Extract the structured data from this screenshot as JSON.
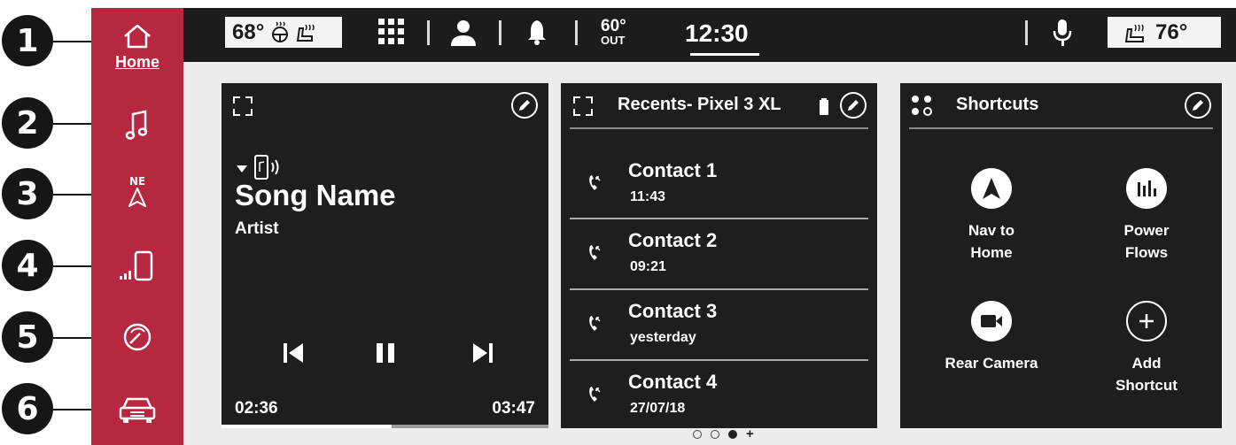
{
  "callouts": [
    "1",
    "2",
    "3",
    "4",
    "5",
    "6"
  ],
  "sidebar": {
    "home_label": "Home",
    "nav_heading": "NE",
    "items": [
      {
        "icon": "home-icon"
      },
      {
        "icon": "music-note-icon"
      },
      {
        "icon": "navigation-arrow-icon"
      },
      {
        "icon": "phone-signal-icon"
      },
      {
        "icon": "gauge-icon"
      },
      {
        "icon": "car-icon"
      }
    ]
  },
  "status_bar": {
    "driver_temp": "68°",
    "outside_temp": "60°",
    "outside_label": "OUT",
    "clock": "12:30",
    "passenger_temp": "76°"
  },
  "media_card": {
    "song": "Song Name",
    "artist": "Artist",
    "elapsed": "02:36",
    "duration": "03:47",
    "progress": 0.52
  },
  "recents_card": {
    "title": "Recents- Pixel 3 XL",
    "contacts": [
      {
        "name": "Contact 1",
        "time": "11:43"
      },
      {
        "name": "Contact 2",
        "time": "09:21"
      },
      {
        "name": "Contact 3",
        "time": "yesterday"
      },
      {
        "name": "Contact 4",
        "time": "27/07/18"
      }
    ]
  },
  "shortcuts_card": {
    "title": "Shortcuts",
    "items": [
      {
        "label": "Nav to\nHome",
        "icon": "navigation-arrow-icon"
      },
      {
        "label": "Power\nFlows",
        "icon": "power-flows-icon"
      },
      {
        "label": "Rear Camera",
        "icon": "camera-icon"
      },
      {
        "label": "Add\nShortcut",
        "icon": "plus-icon"
      }
    ]
  },
  "pager": {
    "pages": 3,
    "active": 2
  },
  "colors": {
    "sidebar": "#b5283f",
    "status_bar": "#1c1c1c",
    "card": "#1e1e1e",
    "screen": "#ececec"
  }
}
